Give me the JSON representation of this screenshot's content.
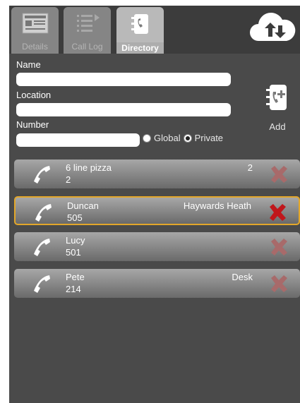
{
  "tabs": [
    {
      "label": "Details",
      "icon": "contact-card-icon"
    },
    {
      "label": "Call Log",
      "icon": "list-icon"
    },
    {
      "label": "Directory",
      "icon": "phone-book-icon"
    }
  ],
  "header": {
    "sync_icon": "cloud-sync-icon"
  },
  "form": {
    "name_label": "Name",
    "location_label": "Location",
    "number_label": "Number",
    "name_value": "",
    "location_value": "",
    "number_value": "",
    "radio_global": "Global",
    "radio_private": "Private",
    "selected_scope": "Private"
  },
  "add_button": {
    "label": "Add",
    "icon": "add-contact-icon"
  },
  "contacts": [
    {
      "name": "6 line pizza",
      "number": "2",
      "location": "2",
      "selected": false
    },
    {
      "name": "Duncan",
      "number": "505",
      "location": "Haywards Heath",
      "selected": true
    },
    {
      "name": "Lucy",
      "number": "501",
      "location": "",
      "selected": false
    },
    {
      "name": "Pete",
      "number": "214",
      "location": "Desk",
      "selected": false
    }
  ],
  "colors": {
    "background": "#4a4a4a",
    "active_tab": "#b9b9b9",
    "inactive_tab": "#858585",
    "selected_border": "#e3a72a",
    "delete_active": "#c0171b",
    "delete_inactive": "#a86a6a"
  }
}
